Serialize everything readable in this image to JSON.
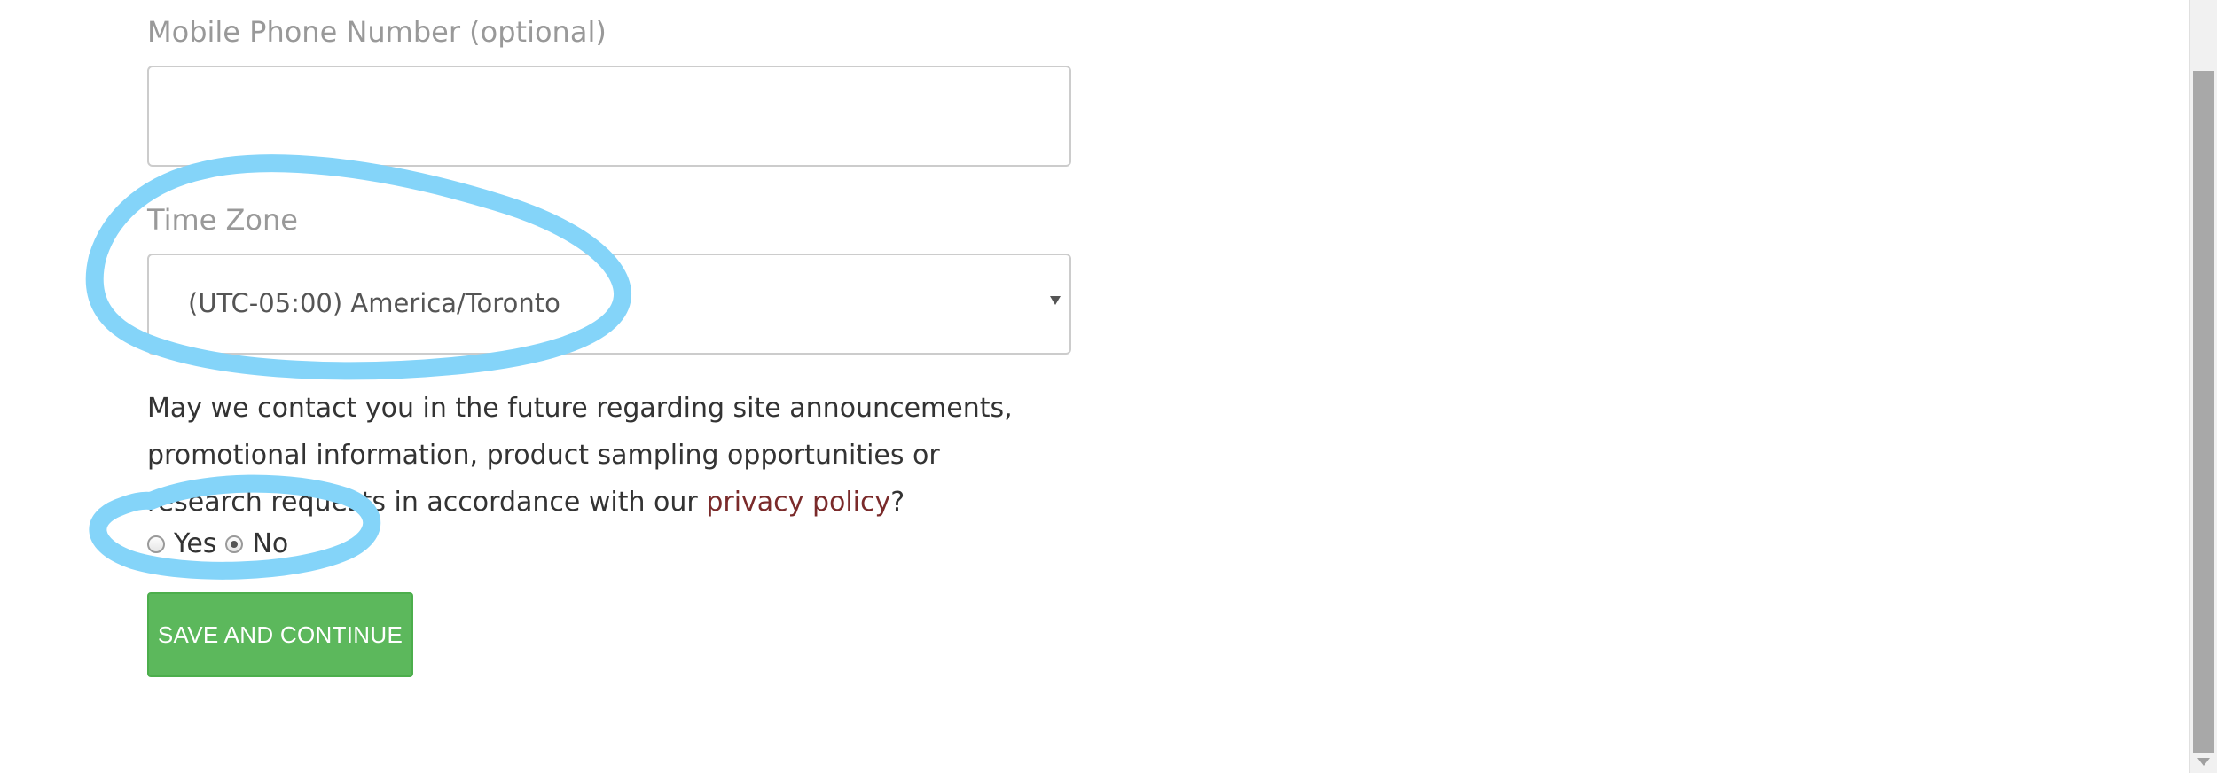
{
  "form": {
    "phone_label": "Mobile Phone Number (optional)",
    "phone_value": "",
    "timezone_label": "Time Zone",
    "timezone_value": "(UTC-05:00) America/Toronto",
    "contact_question": "May we contact you in the future regarding site announcements, promotional information, product sampling opportunities or research requests in accordance with our",
    "privacy_link": "privacy policy",
    "question_end": "?",
    "radio_yes": "Yes",
    "radio_no": "No",
    "selected_option": "No",
    "submit_label": "SAVE AND CONTINUE"
  },
  "icons": {
    "select_caret": "chevron-down-icon",
    "scroll_down": "arrow-down-icon"
  },
  "colors": {
    "submit_button": "#5cb85c",
    "link": "#7a2a2a",
    "annotation": "#84d4f9"
  }
}
